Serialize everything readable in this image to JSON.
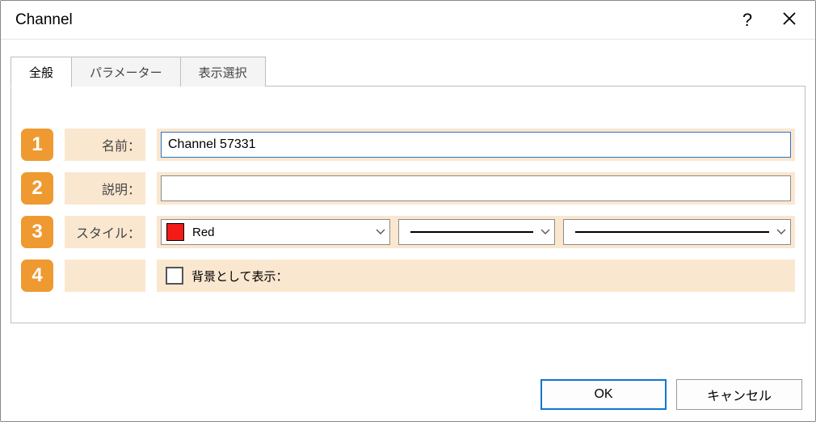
{
  "title": "Channel",
  "tabs": {
    "general": "全般",
    "parameter": "パラメーター",
    "display": "表示選択"
  },
  "rows": {
    "r1": {
      "num": "1",
      "label": "名前：",
      "value": "Channel 57331"
    },
    "r2": {
      "num": "2",
      "label": "説明：",
      "value": ""
    },
    "r3": {
      "num": "3",
      "label": "スタイル：",
      "color_name": "Red"
    },
    "r4": {
      "num": "4",
      "checkbox_label": "背景として表示："
    }
  },
  "buttons": {
    "ok": "OK",
    "cancel": "キャンセル"
  },
  "icons": {
    "help": "?",
    "close": "✕"
  }
}
